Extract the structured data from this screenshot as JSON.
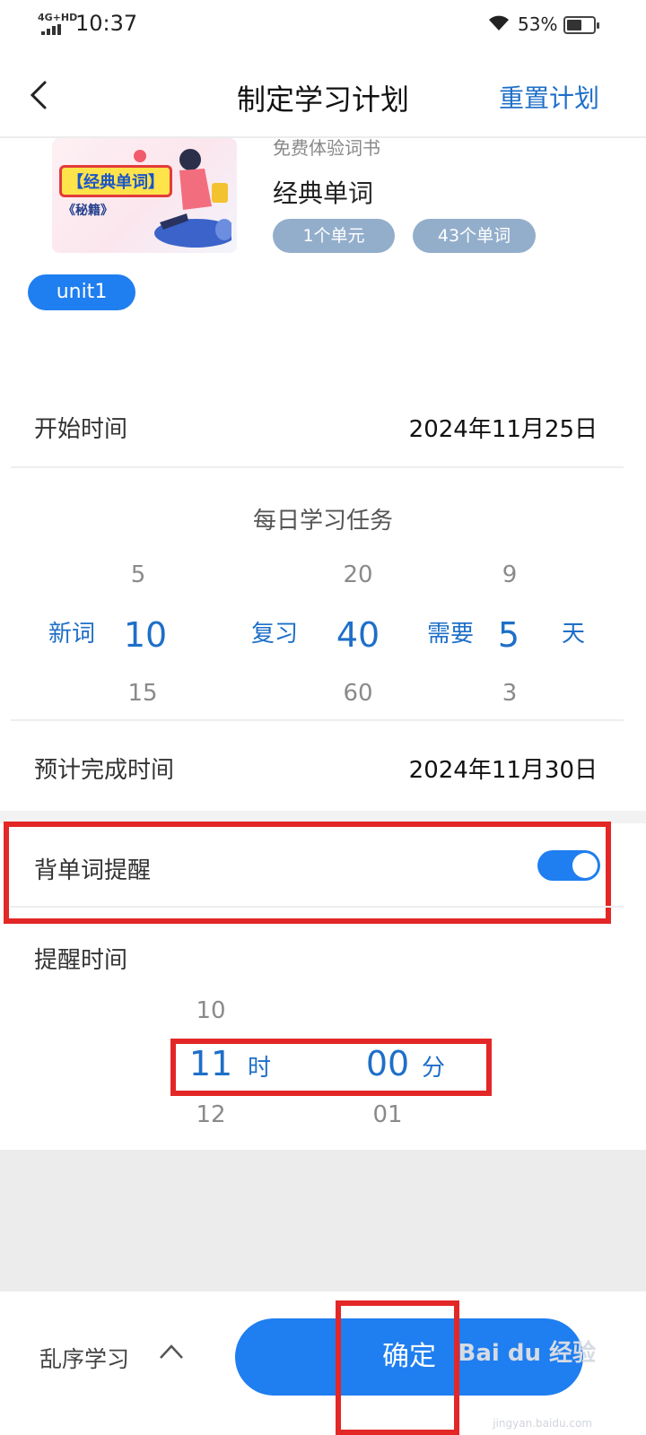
{
  "status_bar": {
    "network": "4G+HD",
    "time": "10:37",
    "battery_percent": "53%",
    "battery_level": 0.53
  },
  "nav": {
    "title": "制定学习计划",
    "reset_label": "重置计划"
  },
  "book": {
    "category": "免费体验词书",
    "name": "经典单词",
    "cover_title": "【经典单词】",
    "cover_subtitle": "《秘籍》",
    "units_pill": "1个单元",
    "words_pill": "43个单词"
  },
  "unit_chip": "unit1",
  "start": {
    "label": "开始时间",
    "value": "2024年11月25日"
  },
  "daily_task": {
    "title": "每日学习任务",
    "new_words": {
      "label": "新词",
      "prev": "5",
      "selected": "10",
      "next": "15"
    },
    "review": {
      "label": "复习",
      "prev": "20",
      "selected": "40",
      "next": "60"
    },
    "need_days": {
      "label": "需要",
      "prev": "9",
      "selected": "5",
      "next": "3",
      "unit": "天"
    }
  },
  "finish": {
    "label": "预计完成时间",
    "value": "2024年11月30日"
  },
  "reminder": {
    "label": "背单词提醒",
    "enabled": true,
    "time_label": "提醒时间",
    "hour": {
      "prev": "10",
      "selected": "11",
      "next": "12",
      "unit": "时"
    },
    "minute": {
      "selected": "00",
      "next": "01",
      "unit": "分"
    }
  },
  "bottom": {
    "shuffle_label": "乱序学习",
    "confirm_label": "确定"
  },
  "watermark": {
    "brand": "Bai du 经验",
    "url": "jingyan.baidu.com"
  },
  "colors": {
    "accent": "#1f7ef0",
    "link": "#1e6fc8",
    "pill": "#93aecb",
    "highlight": "#e32727"
  }
}
